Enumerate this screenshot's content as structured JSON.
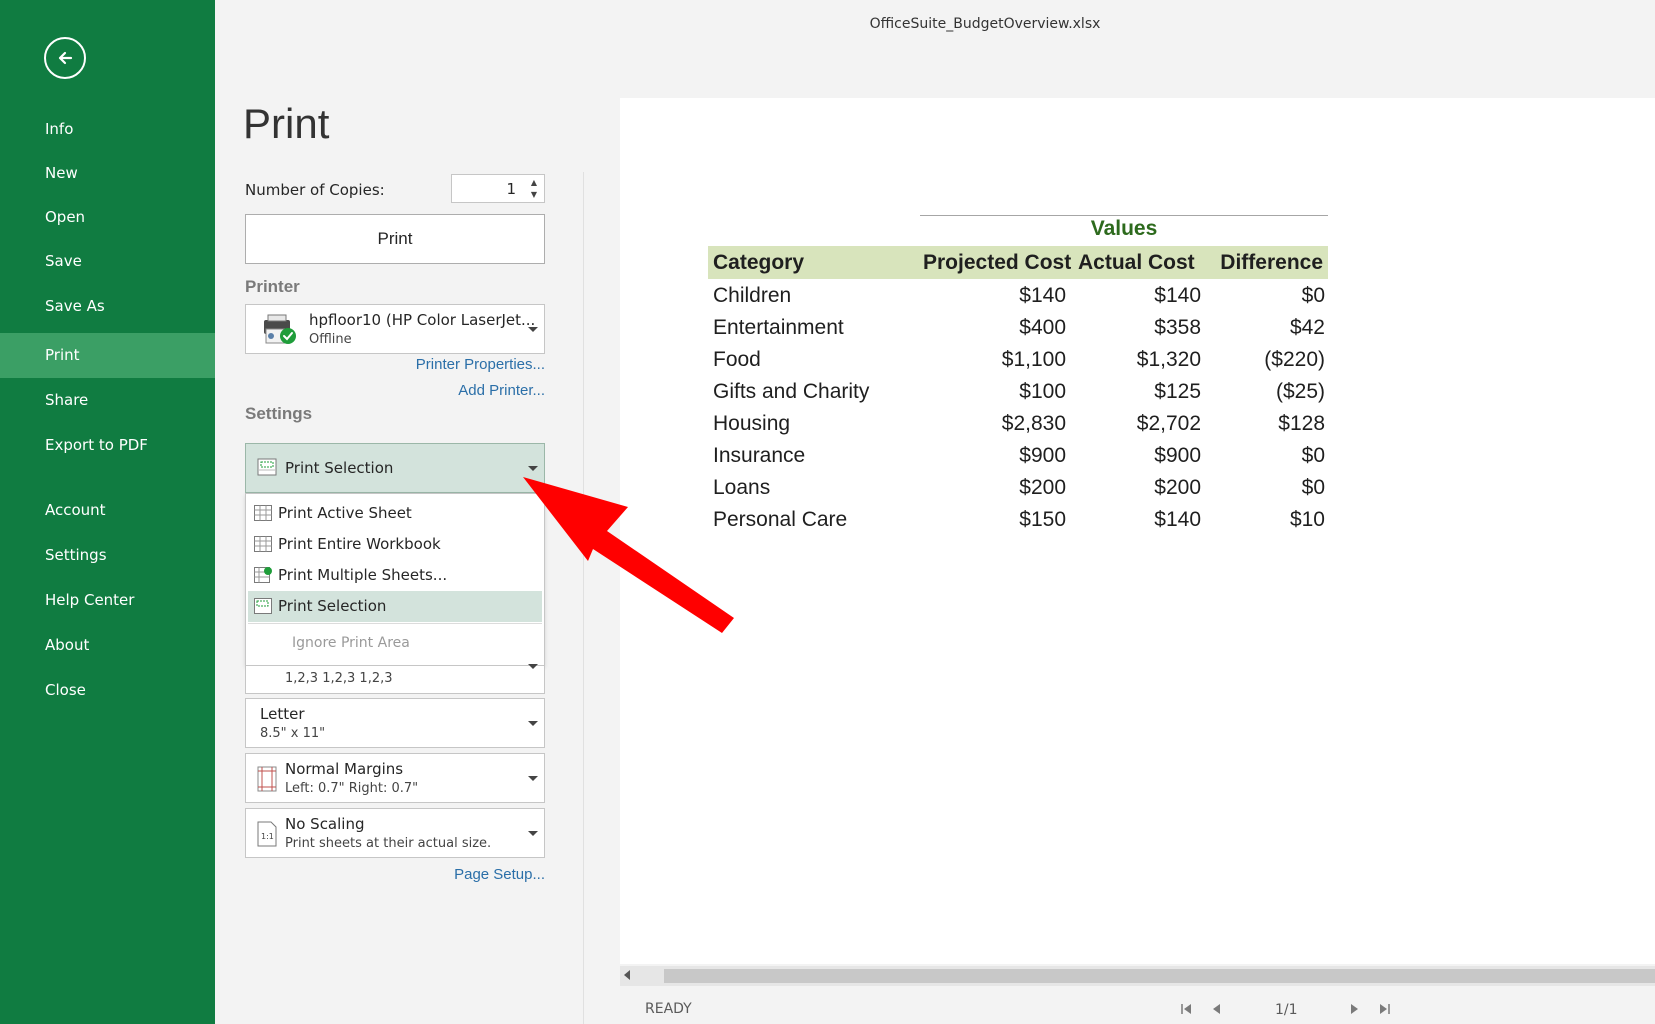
{
  "window": {
    "title": "OfficeSuite_BudgetOverview.xlsx"
  },
  "sidebar": {
    "items": [
      {
        "label": "Info"
      },
      {
        "label": "New"
      },
      {
        "label": "Open"
      },
      {
        "label": "Save"
      },
      {
        "label": "Save As"
      },
      {
        "label": "Print",
        "active": true
      },
      {
        "label": "Share"
      },
      {
        "label": "Export to PDF"
      },
      {
        "label": "Account"
      },
      {
        "label": "Settings"
      },
      {
        "label": "Help Center"
      },
      {
        "label": "About"
      },
      {
        "label": "Close"
      }
    ]
  },
  "print_panel": {
    "heading": "Print",
    "copies_label": "Number of Copies:",
    "copies_value": "1",
    "print_button": "Print",
    "printer_section": "Printer",
    "printer_name": "hpfloor10 (HP Color LaserJet...",
    "printer_status": "Offline",
    "printer_properties_link": "Printer Properties...",
    "add_printer_link": "Add Printer...",
    "settings_section": "Settings",
    "selection_dropdown": "Print Selection",
    "menu": {
      "items": [
        {
          "label": "Print Active Sheet"
        },
        {
          "label": "Print Entire Workbook"
        },
        {
          "label": "Print Multiple Sheets..."
        },
        {
          "label": "Print Selection",
          "selected": true
        }
      ],
      "ignore_print_area": "Ignore Print Area"
    },
    "collate_sub": "1,2,3   1,2,3   1,2,3",
    "paper": {
      "title": "Letter",
      "sub": "8.5\" x 11\""
    },
    "margins": {
      "title": "Normal Margins",
      "sub": "Left: 0.7\"   Right: 0.7\""
    },
    "scaling": {
      "title": "No Scaling",
      "sub": "Print sheets at their actual size."
    },
    "page_setup_link": "Page Setup..."
  },
  "preview": {
    "values_label": "Values",
    "headers": [
      "Category",
      "Projected Cost",
      "Actual Cost",
      "Difference"
    ],
    "rows": [
      [
        "Children",
        "$140",
        "$140",
        "$0"
      ],
      [
        "Entertainment",
        "$400",
        "$358",
        "$42"
      ],
      [
        "Food",
        "$1,100",
        "$1,320",
        "($220)"
      ],
      [
        "Gifts and Charity",
        "$100",
        "$125",
        "($25)"
      ],
      [
        "Housing",
        "$2,830",
        "$2,702",
        "$128"
      ],
      [
        "Insurance",
        "$900",
        "$900",
        "$0"
      ],
      [
        "Loans",
        "$200",
        "$200",
        "$0"
      ],
      [
        "Personal Care",
        "$150",
        "$140",
        "$10"
      ]
    ]
  },
  "status": {
    "text": "READY",
    "page_indicator": "1/1"
  },
  "colors": {
    "sidebar": "#107c41",
    "sidebar_active": "#3b9f65",
    "header_row": "#d8e4bc",
    "values_text": "#2d6a1d",
    "annotation_arrow": "#ff0000",
    "link": "#2b6fa8"
  }
}
